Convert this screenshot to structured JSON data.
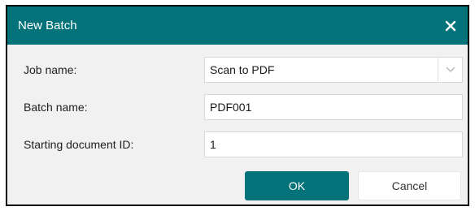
{
  "dialog": {
    "title": "New Batch",
    "close_icon": "close-icon"
  },
  "form": {
    "job_name_label": "Job name:",
    "job_name_value": "Scan to PDF",
    "batch_name_label": "Batch name:",
    "batch_name_value": "PDF001",
    "start_id_label": "Starting document ID:",
    "start_id_value": "1"
  },
  "buttons": {
    "ok_label": "OK",
    "cancel_label": "Cancel"
  },
  "colors": {
    "accent": "#047379",
    "dialog_background": "#f1f1f1"
  }
}
